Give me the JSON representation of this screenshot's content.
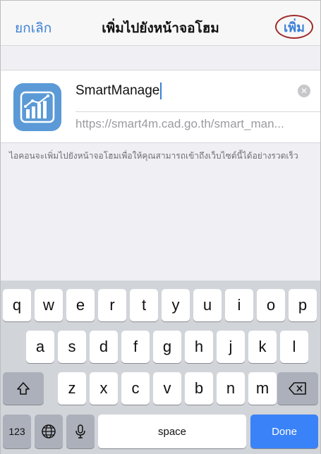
{
  "navbar": {
    "cancel_label": "ยกเลิก",
    "title": "เพิ่มไปยังหน้าจอโฮม",
    "add_label": "เพิ่ม"
  },
  "bookmark": {
    "name_value": "SmartManage",
    "clear_icon": "clear-circle-icon",
    "url_value": "https://smart4m.cad.go.th/smart_man..."
  },
  "hint_text": "ไอคอนจะเพิ่มไปยังหน้าจอโฮมเพื่อให้คุณสามารถเข้าถึงเว็บไซต์นี้ได้อย่างรวดเร็ว",
  "keyboard": {
    "row1": [
      "q",
      "w",
      "e",
      "r",
      "t",
      "y",
      "u",
      "i",
      "o",
      "p"
    ],
    "row2": [
      "a",
      "s",
      "d",
      "f",
      "g",
      "h",
      "j",
      "k",
      "l"
    ],
    "row3": [
      "z",
      "x",
      "c",
      "v",
      "b",
      "n",
      "m"
    ],
    "numbers_label": "123",
    "space_label": "space",
    "done_label": "Done"
  },
  "colors": {
    "accent": "#3b7fd6",
    "annotation_circle": "#a02a2a",
    "done_key": "#3a82f7"
  }
}
